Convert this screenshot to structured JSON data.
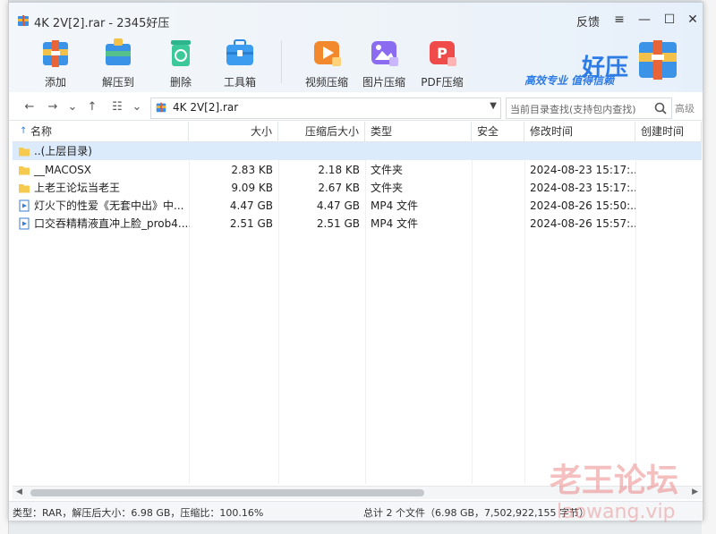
{
  "window": {
    "title": "4K 2V[2].rar - 2345好压",
    "feedback": "反馈",
    "controls": [
      "≡",
      "—",
      "☐",
      "✕"
    ]
  },
  "toolbar": {
    "add": "添加",
    "extract": "解压到",
    "delete": "删除",
    "tools": "工具箱",
    "video": "视频压缩",
    "image": "图片压缩",
    "pdf": "PDF压缩"
  },
  "brand": {
    "word": "好压",
    "slogan": "高效专业  值得信赖"
  },
  "address": {
    "path": "4K 2V[2].rar",
    "search_placeholder": "当前目录查找(支持包内查找)",
    "advanced": "高级"
  },
  "columns": [
    "名称",
    "大小",
    "压缩后大小",
    "类型",
    "安全",
    "修改时间",
    "创建时间"
  ],
  "rows": [
    {
      "name": "..(上层目录)",
      "size": "",
      "packed": "",
      "type": "",
      "security": "",
      "modified": "",
      "created": "",
      "icon": "folder-icon",
      "selected": true
    },
    {
      "name": "__MACOSX",
      "size": "2.83 KB",
      "packed": "2.18 KB",
      "type": "文件夹",
      "security": "",
      "modified": "2024-08-23 15:17:...",
      "created": "",
      "icon": "folder-icon"
    },
    {
      "name": "上老王论坛当老王",
      "size": "9.09 KB",
      "packed": "2.67 KB",
      "type": "文件夹",
      "security": "",
      "modified": "2024-08-23 15:17:...",
      "created": "",
      "icon": "folder-icon"
    },
    {
      "name": "灯火下的性爱《无套中出》中...",
      "size": "4.47 GB",
      "packed": "4.47 GB",
      "type": "MP4 文件",
      "security": "",
      "modified": "2024-08-26 15:50:...",
      "created": "",
      "icon": "video-file-icon"
    },
    {
      "name": "口交吞精精液直冲上脸_prob4....",
      "size": "2.51 GB",
      "packed": "2.51 GB",
      "type": "MP4 文件",
      "security": "",
      "modified": "2024-08-26 15:57:...",
      "created": "",
      "icon": "video-file-icon"
    }
  ],
  "status": {
    "left": "类型：RAR，解压后大小：6.98 GB，压缩比：100.16%",
    "right": "总计 2 个文件（6.98 GB，7,502,922,155 字节）"
  },
  "watermark": {
    "line1": "老王论坛",
    "line2": "laowang.vip"
  },
  "colors": {
    "accent": "#2d7be5",
    "selected_row": "#dcebfb",
    "folder": "#f6c94f",
    "watermark": "#e87070"
  }
}
